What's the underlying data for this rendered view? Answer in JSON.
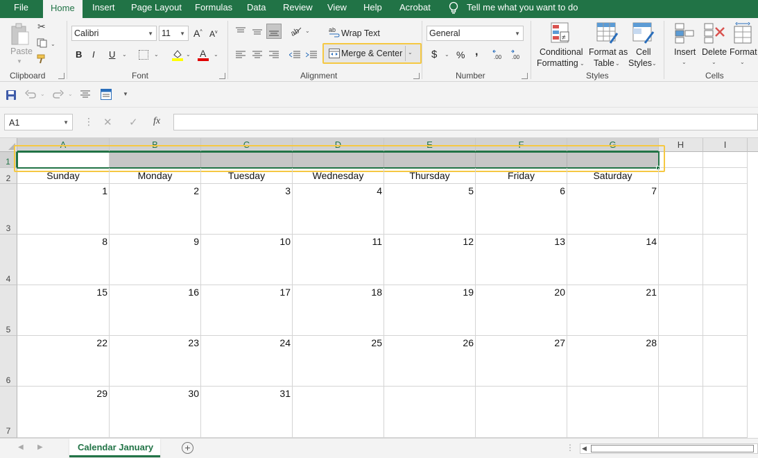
{
  "menu_tabs": [
    "File",
    "Home",
    "Insert",
    "Page Layout",
    "Formulas",
    "Data",
    "Review",
    "View",
    "Help",
    "Acrobat"
  ],
  "tell_me": "Tell me what you want to do",
  "ribbon": {
    "clipboard": {
      "paste": "Paste",
      "label": "Clipboard"
    },
    "font": {
      "name": "Calibri",
      "size": "11",
      "label": "Font",
      "bold": "B",
      "italic": "I",
      "underline": "U"
    },
    "alignment": {
      "wrap_text": "Wrap Text",
      "merge_center": "Merge & Center",
      "label": "Alignment"
    },
    "number": {
      "format": "General",
      "label": "Number",
      "currency": "$",
      "percent": "%",
      "comma": ","
    },
    "styles": {
      "conditional_1": "Conditional",
      "conditional_2": "Formatting",
      "format_table_1": "Format as",
      "format_table_2": "Table",
      "cell_styles_1": "Cell",
      "cell_styles_2": "Styles",
      "label": "Styles"
    },
    "cells": {
      "insert": "Insert",
      "delete": "Delete",
      "format": "Format",
      "label": "Cells"
    }
  },
  "formula_bar": {
    "name_box": "A1",
    "fx": "fx",
    "formula": ""
  },
  "columns": [
    "A",
    "B",
    "C",
    "D",
    "E",
    "F",
    "G",
    "H",
    "I"
  ],
  "rows": [
    "1",
    "2",
    "3",
    "4",
    "5",
    "6",
    "7"
  ],
  "day_names": [
    "Sunday",
    "Monday",
    "Tuesday",
    "Wednesday",
    "Thursday",
    "Friday",
    "Saturday"
  ],
  "weeks": [
    [
      "1",
      "2",
      "3",
      "4",
      "5",
      "6",
      "7"
    ],
    [
      "8",
      "9",
      "10",
      "11",
      "12",
      "13",
      "14"
    ],
    [
      "15",
      "16",
      "17",
      "18",
      "19",
      "20",
      "21"
    ],
    [
      "22",
      "23",
      "24",
      "25",
      "26",
      "27",
      "28"
    ],
    [
      "29",
      "30",
      "31",
      "",
      "",
      "",
      ""
    ]
  ],
  "sheet_tab": "Calendar January",
  "colors": {
    "excel_green": "#217346",
    "highlight": "#f5c842",
    "selection_fill": "#c6c6c6"
  }
}
